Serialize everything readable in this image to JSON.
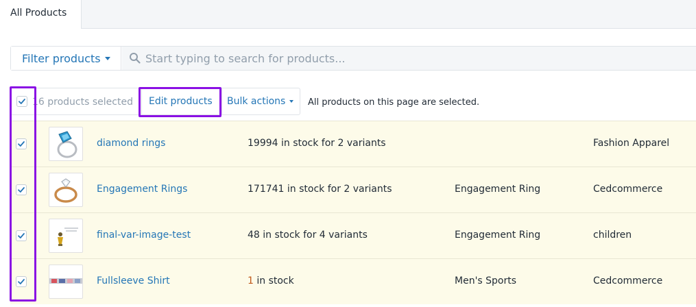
{
  "tabs": {
    "active_label": "All Products"
  },
  "filter": {
    "button_label": "Filter products",
    "search_placeholder": "Start typing to search for products..."
  },
  "bulk": {
    "count_text": "16 products selected",
    "edit_label": "Edit products",
    "actions_label": "Bulk actions",
    "selected_message": "All products on this page are selected."
  },
  "products": [
    {
      "name": "diamond rings",
      "stock_count": "",
      "stock_text": "19994 in stock for 2 variants",
      "type": "",
      "vendor": "Fashion Apparel",
      "checked": true,
      "thumb_icon": "blue-gem-ring"
    },
    {
      "name": "Engagement Rings",
      "stock_count": "",
      "stock_text": "171741 in stock for 2 variants",
      "type": "Engagement Ring",
      "vendor": "Cedcommerce",
      "checked": true,
      "thumb_icon": "gold-diamond-ring"
    },
    {
      "name": "final-var-image-test",
      "stock_count": "",
      "stock_text": "48 in stock for 4 variants",
      "type": "Engagement Ring",
      "vendor": "children",
      "checked": true,
      "thumb_icon": "small-figure-image"
    },
    {
      "name": "Fullsleeve Shirt",
      "stock_count": "1",
      "stock_text": " in stock",
      "type": "Men's Sports",
      "vendor": "Cedcommerce",
      "checked": true,
      "thumb_icon": "shirt-banner-image"
    }
  ],
  "colors": {
    "link": "#2476b6",
    "highlight": "#8a10e4",
    "row_bg": "#fdfbe9",
    "low_stock": "#c05717"
  }
}
